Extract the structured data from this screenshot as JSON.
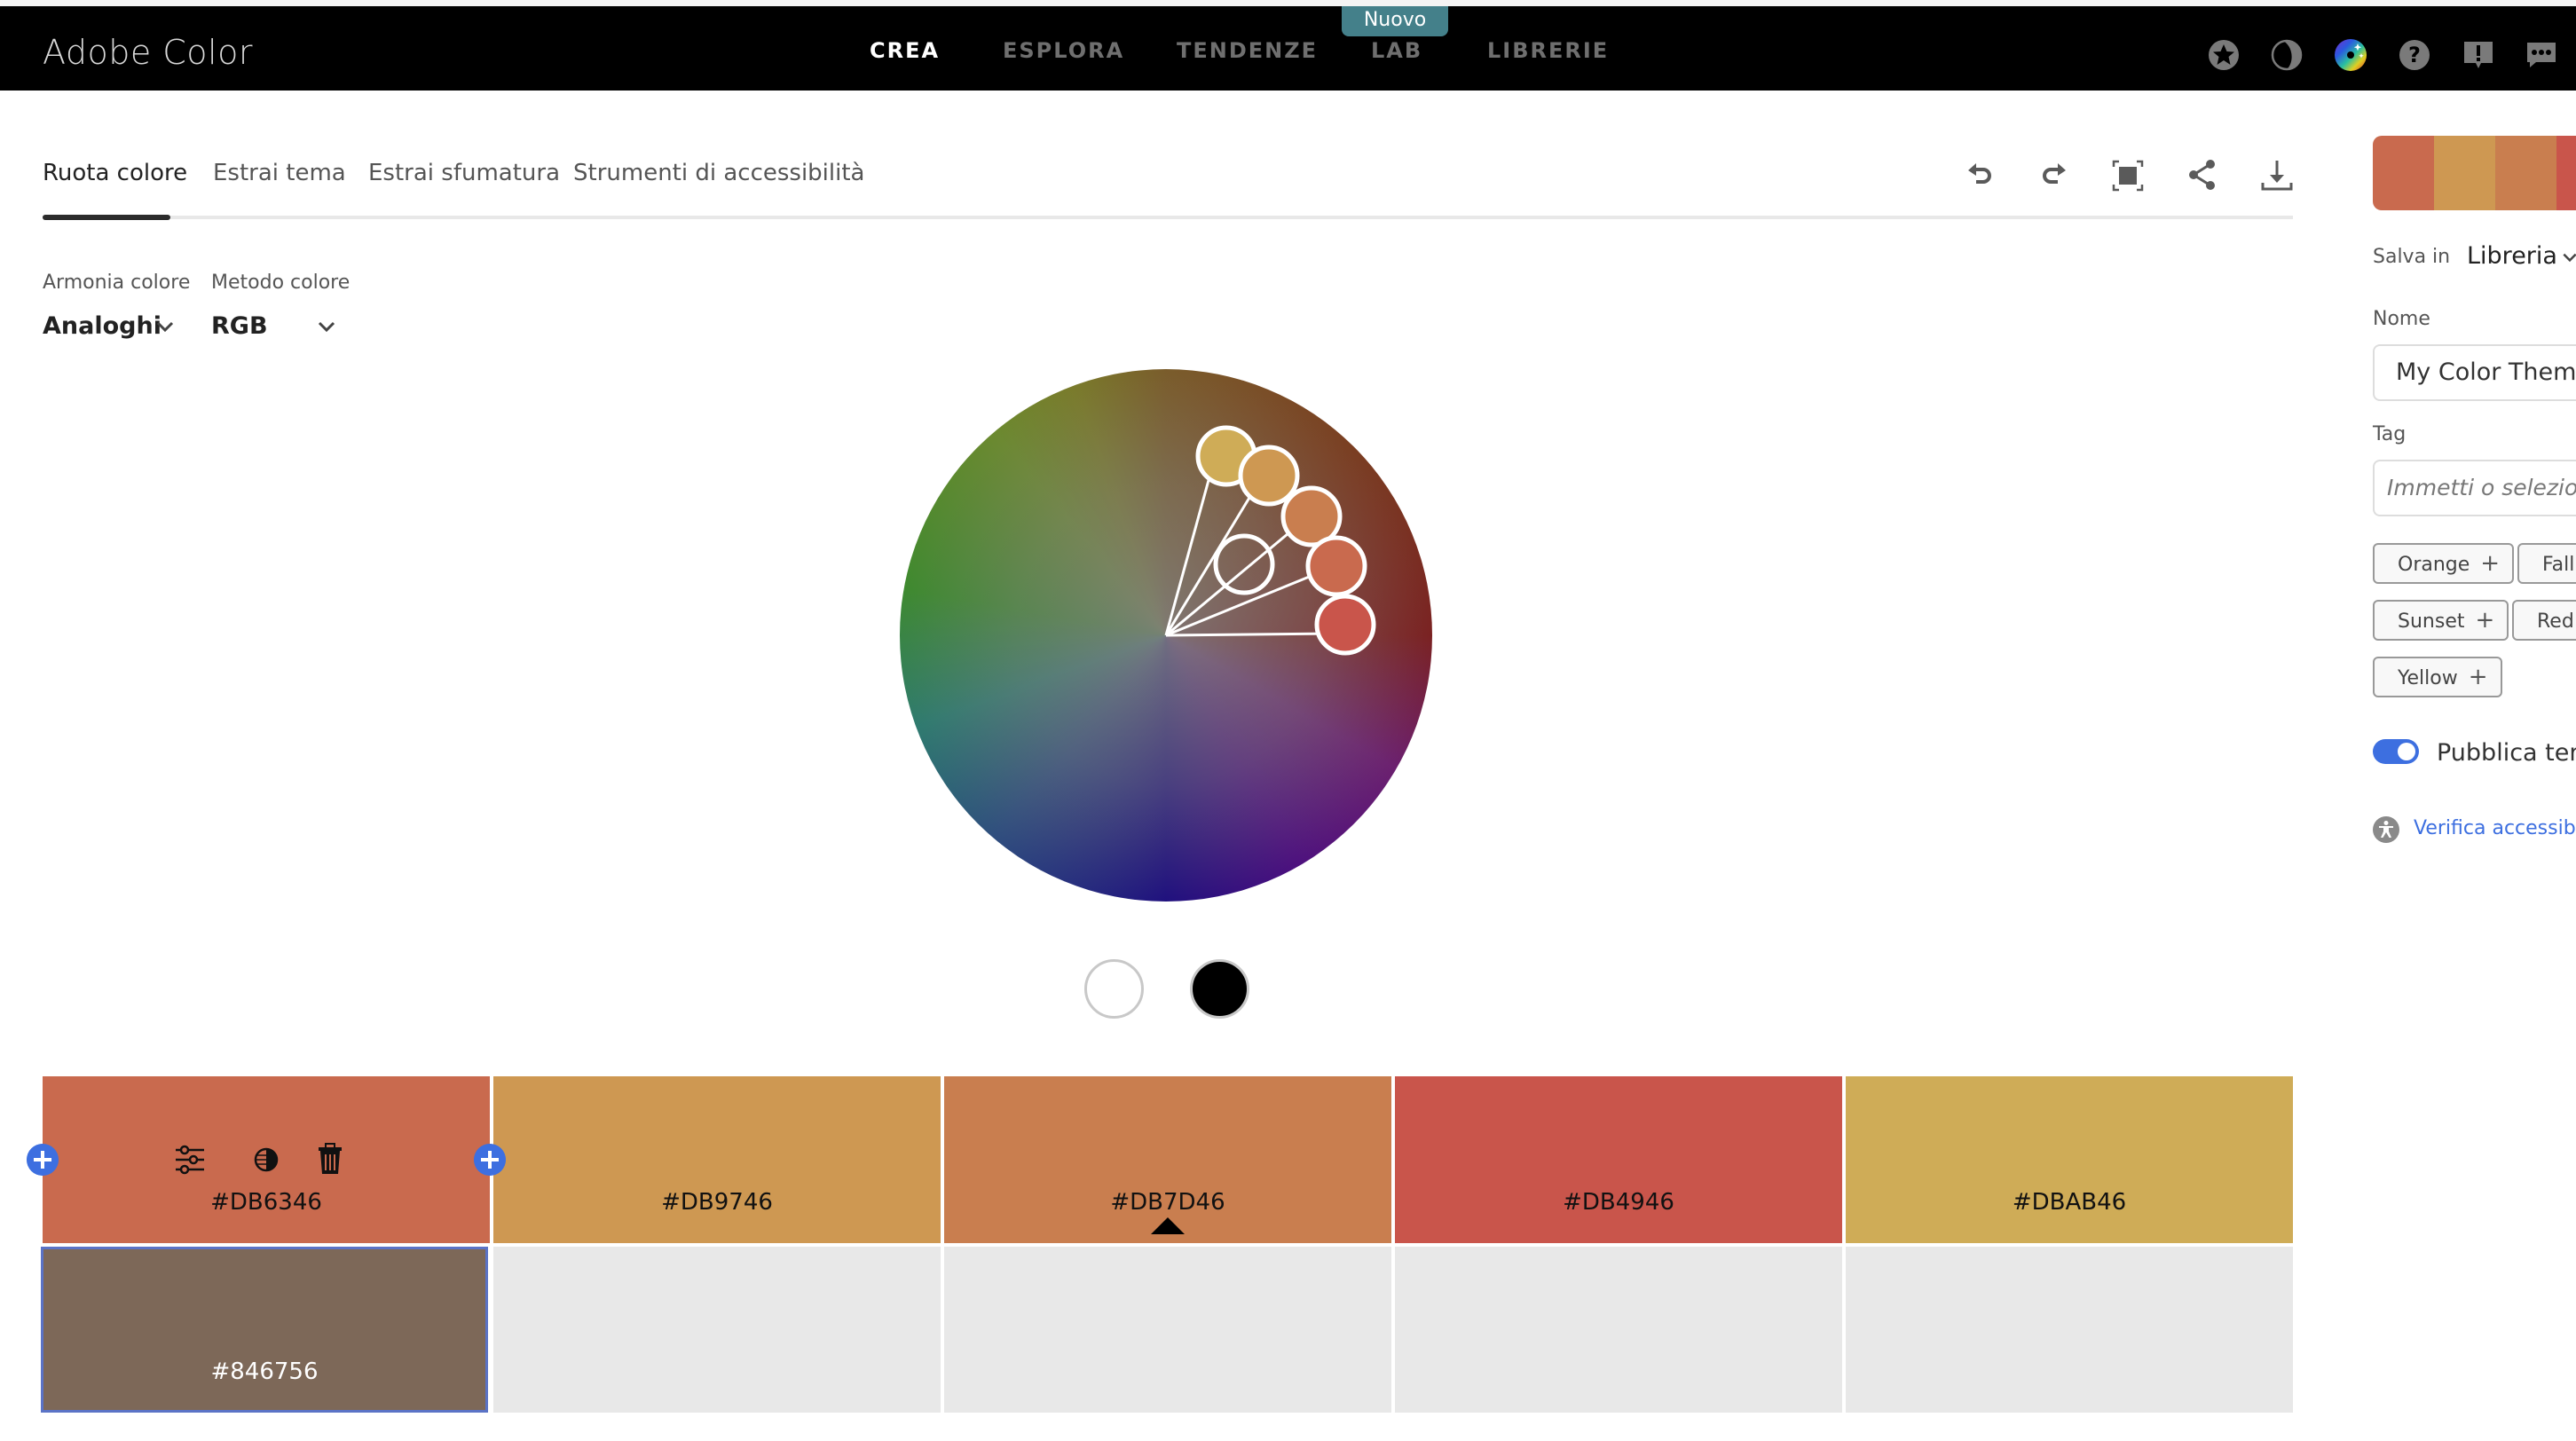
{
  "app": {
    "title": "Adobe Color",
    "badge_new": "Nuovo"
  },
  "nav": [
    {
      "label": "CREA",
      "active": true
    },
    {
      "label": "ESPLORA",
      "active": false
    },
    {
      "label": "TENDENZE",
      "active": false
    },
    {
      "label": "LAB",
      "active": false
    },
    {
      "label": "LIBRERIE",
      "active": false
    }
  ],
  "top_icons": [
    "star-icon",
    "dark-mode-icon",
    "color-wheel-sparkle-icon",
    "help-icon",
    "feedback-alert-icon",
    "chat-icon"
  ],
  "tabs": [
    {
      "label": "Ruota colore",
      "active": true
    },
    {
      "label": "Estrai tema",
      "active": false
    },
    {
      "label": "Estrai sfumatura",
      "active": false
    },
    {
      "label": "Strumenti di accessibilità",
      "active": false
    }
  ],
  "toolbar_icons": [
    "undo-icon",
    "redo-icon",
    "fullscreen-icon",
    "share-icon",
    "download-icon"
  ],
  "harmony": {
    "label": "Armonia colore",
    "value": "Analoghi"
  },
  "method": {
    "label": "Metodo colore",
    "value": "RGB"
  },
  "swatches": [
    {
      "hex": "#DB6346",
      "display": "#C96A4E",
      "text_color": "#111111",
      "active_tools": true
    },
    {
      "hex": "#DB9746",
      "display": "#CE9852",
      "text_color": "#111111"
    },
    {
      "hex": "#DB7D46",
      "display": "#C97E4F",
      "text_color": "#111111",
      "base": true
    },
    {
      "hex": "#DB4946",
      "display": "#C9554B",
      "text_color": "#111111"
    },
    {
      "hex": "#DBAB46",
      "display": "#CFAC57",
      "text_color": "#111111"
    }
  ],
  "secondary_swatch": {
    "hex": "#846756",
    "display": "#7D6858",
    "text_color": "#ffffff"
  },
  "swatch_tools": [
    "adjust-sliders-icon",
    "contrast-icon",
    "trash-icon"
  ],
  "panel": {
    "save_in_label": "Salva in",
    "save_in_value": "Libreria",
    "name_label": "Nome",
    "name_value": "My Color Theme",
    "tag_label": "Tag",
    "tag_placeholder": "Immetti o seleziona",
    "tags": [
      "Orange",
      "Fall",
      "Sunset",
      "Red",
      "Yellow"
    ],
    "publish_label": "Pubblica tema",
    "publish_on": true,
    "accessibility_link": "Verifica accessibilità"
  },
  "colors": {
    "accent": "#3D6FE0",
    "badge": "#44808A"
  }
}
